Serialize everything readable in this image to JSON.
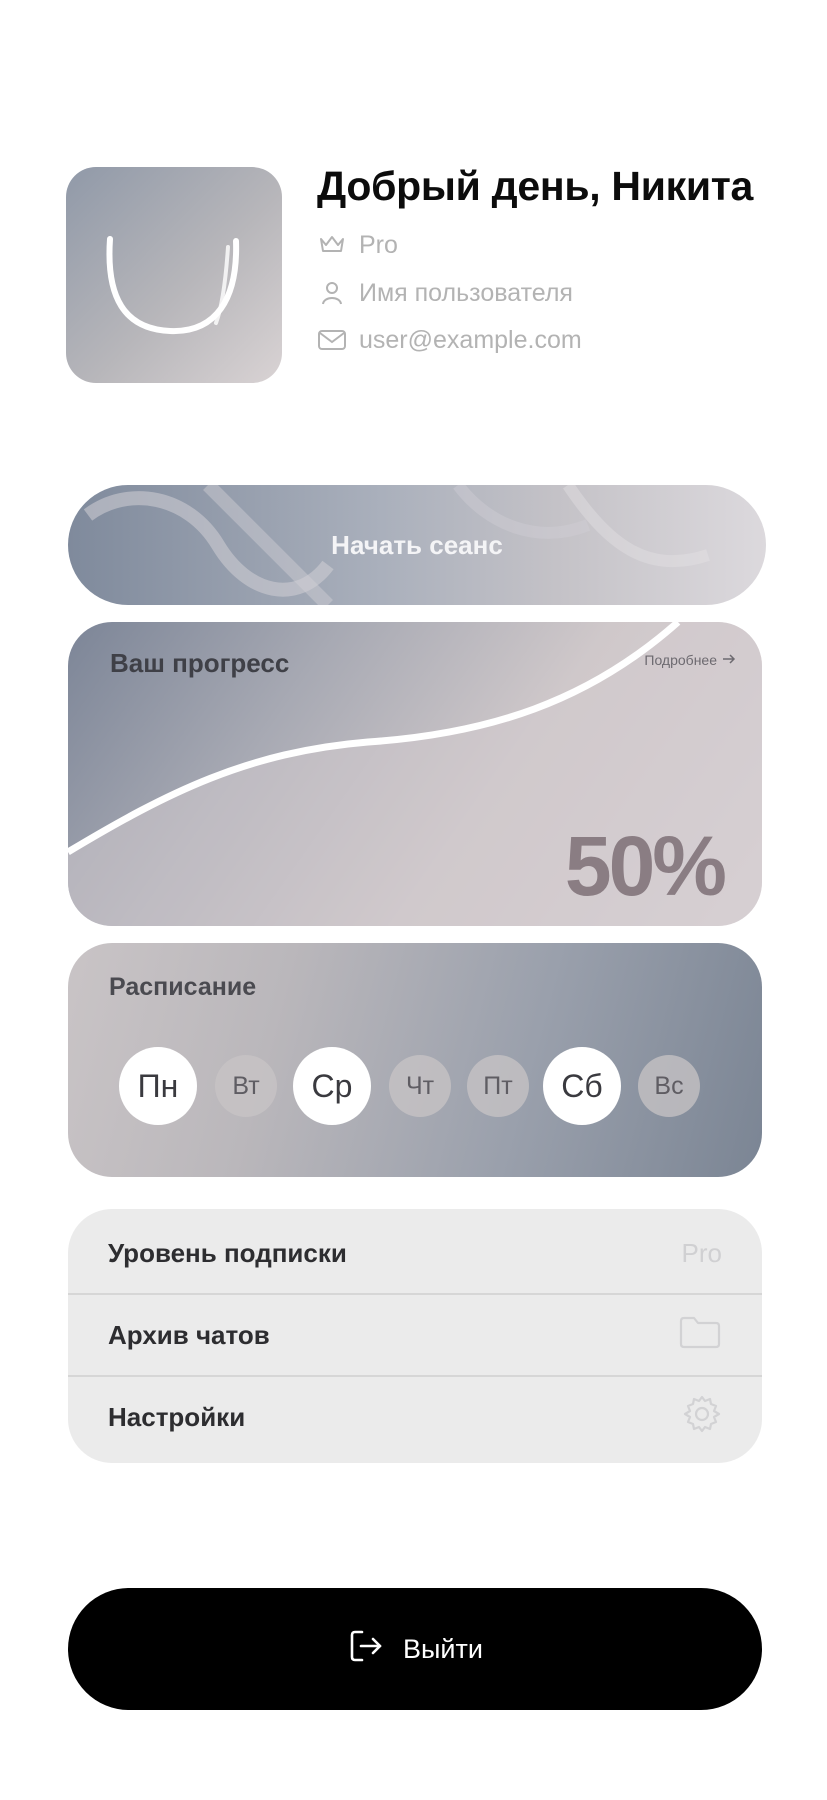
{
  "profile": {
    "greeting": "Добрый день, Никита",
    "plan": "Pro",
    "username": "Имя пользователя",
    "email": "user@example.com",
    "icons": {
      "plan": "crown-icon",
      "username": "user-icon",
      "email": "mail-icon"
    }
  },
  "session": {
    "start_label": "Начать сеанс"
  },
  "progress": {
    "title": "Ваш прогресс",
    "more_label": "Подробнее",
    "more_icon": "arrow-right-icon",
    "value_text": "50%",
    "value": 0.5
  },
  "schedule": {
    "title": "Расписание",
    "days": [
      {
        "label": "Пн",
        "active": true
      },
      {
        "label": "Вт",
        "active": false
      },
      {
        "label": "Ср",
        "active": true
      },
      {
        "label": "Чт",
        "active": false
      },
      {
        "label": "Пт",
        "active": false
      },
      {
        "label": "Сб",
        "active": true
      },
      {
        "label": "Вс",
        "active": false
      }
    ]
  },
  "menu": {
    "items": [
      {
        "label": "Уровень подписки",
        "trailing_text": "Pro"
      },
      {
        "label": "Архив чатов",
        "trailing_icon": "folder-icon"
      },
      {
        "label": "Настройки",
        "trailing_icon": "gear-icon"
      }
    ]
  },
  "logout": {
    "label": "Выйти",
    "icon": "logout-icon"
  },
  "colors": {
    "logout_background": "#000000",
    "menu_background": "#ebebeb",
    "progress_value": "#8a7d83",
    "active_day": "#ffffff"
  }
}
